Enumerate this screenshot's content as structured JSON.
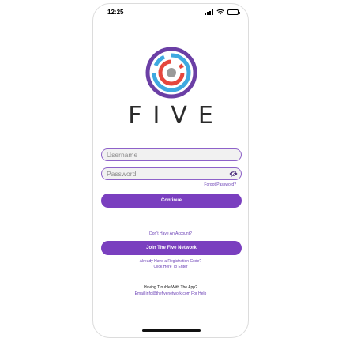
{
  "status_bar": {
    "time": "12:25",
    "icons": [
      "signal-icon",
      "wifi-icon",
      "battery-icon"
    ]
  },
  "brand": {
    "name": "FIVE",
    "logo": "five-network-logo",
    "colors": {
      "purple": "#6b3fa5",
      "blue": "#3fa9e0",
      "red": "#e5463d",
      "gray": "#9a9a9a"
    }
  },
  "form": {
    "username_placeholder": "Username",
    "password_placeholder": "Password",
    "forgot_password": "Forgot Password?",
    "continue_label": "Continue"
  },
  "signup": {
    "no_account": "Don't Have An Account?",
    "join_label": "Join The Five Network",
    "registration_line1": "Already Have a Registration Code?",
    "registration_line2": "Click Here To Enter"
  },
  "help": {
    "trouble": "Having Trouble With The App?",
    "email": "Email info@thefivenetwork.com For Help"
  },
  "theme": {
    "accent": "#7a3fbf",
    "link": "#6a3fb5"
  }
}
